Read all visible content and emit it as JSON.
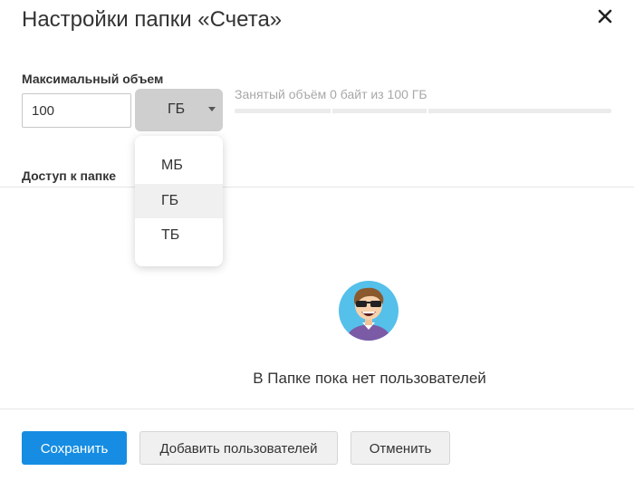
{
  "dialog": {
    "title": "Настройки папки «Счета»"
  },
  "quota": {
    "label": "Максимальный объем",
    "value": "100",
    "unit_selected": "ГБ",
    "usage_text": "Занятый объём 0 байт из 100 ГБ",
    "usage_fraction": 0
  },
  "unit_dropdown": {
    "options": [
      "МБ",
      "ГБ",
      "ТБ"
    ],
    "selected_index": 1
  },
  "access": {
    "label": "Доступ к папке",
    "empty_text": "В Папке пока нет пользователей",
    "avatar_icon": "user-avatar-sunglasses-icon"
  },
  "footer": {
    "save_label": "Сохранить",
    "add_users_label": "Добавить пользователей",
    "cancel_label": "Отменить"
  },
  "colors": {
    "primary": "#168de2",
    "avatar_bg": "#55c0ea",
    "shirt": "#7b5aa6"
  }
}
